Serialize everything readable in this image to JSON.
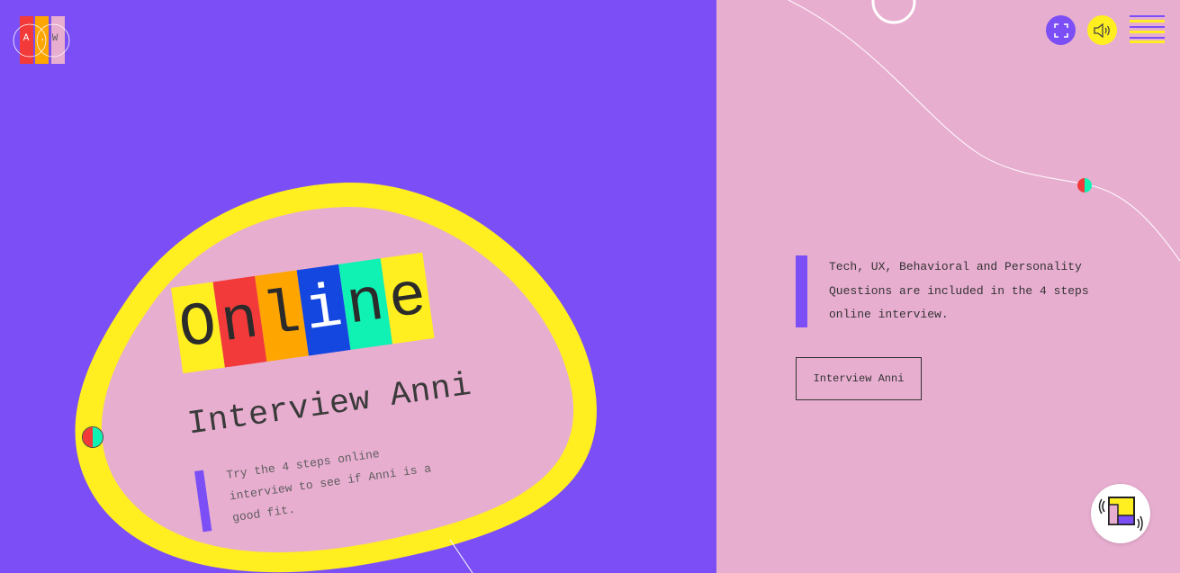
{
  "logo": {
    "letters": [
      "A",
      ".",
      "W"
    ]
  },
  "hero": {
    "title_letters": [
      "O",
      "n",
      "l",
      "i",
      "n",
      "e"
    ],
    "subtitle": "Interview Anni",
    "description": "Try the 4 steps online interview to see if Anni is a good fit."
  },
  "header": {
    "fullscreen_icon": "fullscreen-icon",
    "sound_icon": "speaker-icon",
    "menu_icon": "hamburger-menu-icon"
  },
  "info": {
    "description": "Tech, UX, Behavioral and Personality Questions are included in the 4 steps online interview.",
    "cta_label": "Interview Anni"
  },
  "colors": {
    "purple": "#7b4ff5",
    "pink": "#e8aed0",
    "yellow": "#ffee20",
    "red": "#f23a3a",
    "orange": "#ffa500",
    "blue": "#1446e0",
    "teal": "#0ff2b4"
  },
  "title_cell_colors": [
    "#ffee20",
    "#f23a3a",
    "#ffa500",
    "#1446e0",
    "#0ff2b4",
    "#ffee20"
  ],
  "chat_widget": {
    "icon": "chat-widget-icon"
  }
}
